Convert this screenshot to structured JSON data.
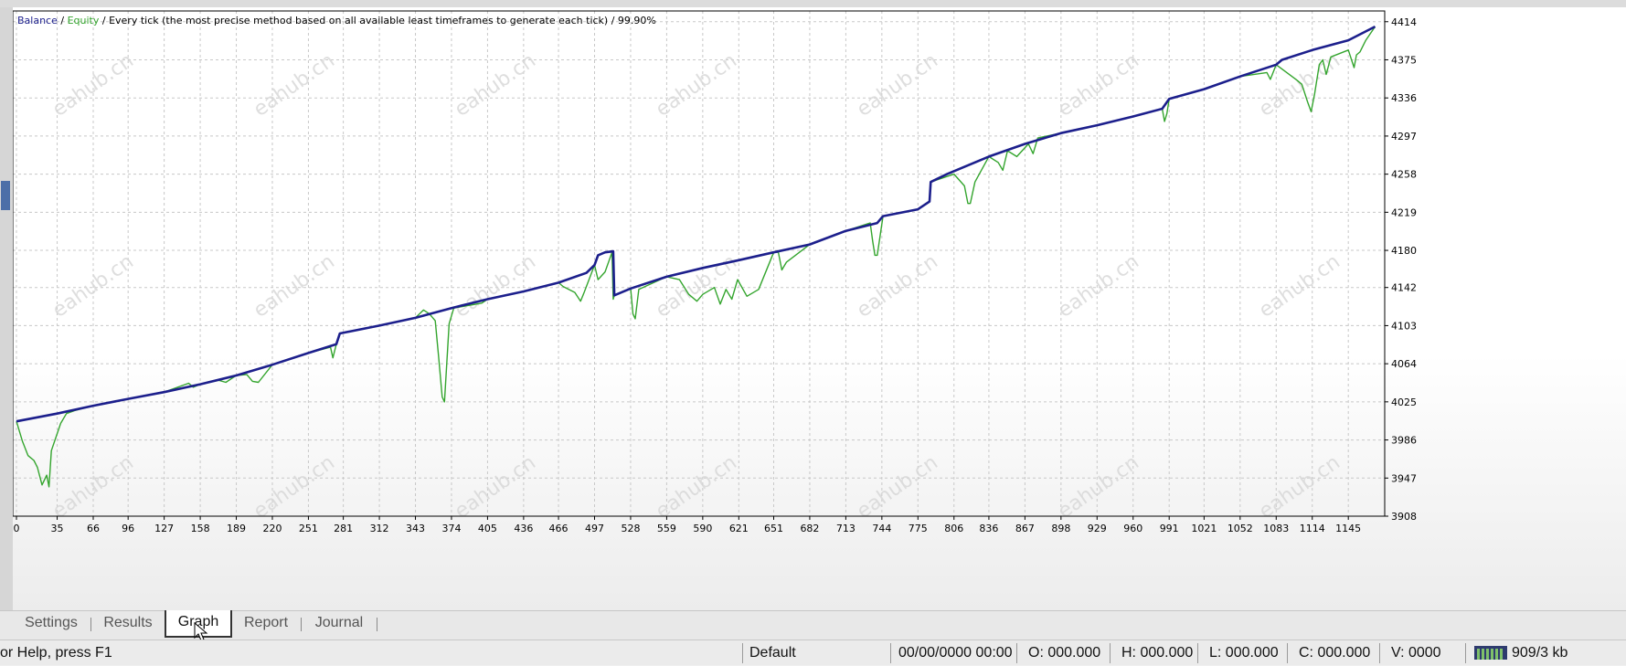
{
  "chart": {
    "legend": {
      "balance_label": "Balance",
      "sep1": " / ",
      "equity_label": "Equity",
      "description": " / Every tick (the most precise method based on all available least timeframes to generate each tick) / 99.90%"
    },
    "watermark": "eahub.cn",
    "colors": {
      "balance": "#1c1f8c",
      "equity": "#34a52e",
      "grid": "#c8c8c8",
      "axis": "#000000"
    }
  },
  "chart_data": {
    "type": "line",
    "title": "",
    "x_ticks": [
      0,
      35,
      66,
      96,
      127,
      158,
      189,
      220,
      251,
      281,
      312,
      343,
      374,
      405,
      436,
      466,
      497,
      528,
      559,
      590,
      621,
      651,
      682,
      713,
      744,
      775,
      806,
      836,
      867,
      898,
      929,
      960,
      991,
      1021,
      1052,
      1083,
      1114,
      1145
    ],
    "y_ticks": [
      3908,
      3947,
      3986,
      4025,
      4064,
      4103,
      4142,
      4180,
      4219,
      4258,
      4297,
      4336,
      4375,
      4414
    ],
    "xlim": [
      0,
      1170
    ],
    "ylim": [
      3908,
      4425
    ],
    "grid": true,
    "legend_position": "top-left",
    "series": [
      {
        "name": "Balance",
        "x": [
          0,
          35,
          66,
          96,
          127,
          158,
          189,
          220,
          251,
          275,
          278,
          312,
          343,
          374,
          405,
          436,
          466,
          490,
          497,
          500,
          506,
          513,
          514,
          528,
          559,
          590,
          621,
          651,
          682,
          713,
          740,
          745,
          775,
          785,
          786,
          800,
          836,
          867,
          898,
          929,
          960,
          985,
          991,
          1021,
          1052,
          1083,
          1088,
          1114,
          1145,
          1168
        ],
        "y": [
          4005,
          4013,
          4021,
          4028,
          4035,
          4043,
          4052,
          4063,
          4075,
          4084,
          4095,
          4103,
          4111,
          4121,
          4130,
          4138,
          4147,
          4157,
          4165,
          4175,
          4178,
          4179,
          4134,
          4141,
          4153,
          4162,
          4170,
          4178,
          4186,
          4200,
          4208,
          4215,
          4222,
          4230,
          4250,
          4258,
          4276,
          4289,
          4300,
          4308,
          4317,
          4325,
          4335,
          4345,
          4358,
          4370,
          4375,
          4385,
          4395,
          4409
        ]
      },
      {
        "name": "Equity",
        "x": [
          0,
          5,
          10,
          15,
          18,
          22,
          26,
          28,
          30,
          38,
          43,
          50,
          66,
          96,
          127,
          148,
          152,
          158,
          174,
          180,
          189,
          198,
          203,
          208,
          220,
          251,
          270,
          272,
          275,
          278,
          312,
          343,
          350,
          355,
          360,
          363,
          366,
          368,
          372,
          376,
          400,
          405,
          436,
          466,
          470,
          480,
          485,
          488,
          497,
          500,
          506,
          512,
          513,
          514,
          528,
          530,
          532,
          535,
          559,
          570,
          578,
          585,
          590,
          600,
          605,
          610,
          615,
          620,
          628,
          638,
          651,
          655,
          658,
          662,
          682,
          713,
          734,
          736,
          738,
          740,
          745,
          775,
          785,
          786,
          806,
          815,
          818,
          820,
          824,
          836,
          844,
          848,
          852,
          860,
          870,
          874,
          878,
          898,
          929,
          960,
          985,
          987,
          989,
          991,
          1021,
          1052,
          1075,
          1078,
          1083,
          1100,
          1105,
          1110,
          1113,
          1116,
          1120,
          1123,
          1126,
          1130,
          1145,
          1150,
          1152,
          1155,
          1160,
          1168
        ],
        "y": [
          4005,
          3985,
          3970,
          3965,
          3958,
          3940,
          3950,
          3938,
          3975,
          4003,
          4013,
          4016,
          4021,
          4028,
          4035,
          4044,
          4040,
          4043,
          4047,
          4045,
          4052,
          4053,
          4046,
          4045,
          4063,
          4075,
          4081,
          4070,
          4084,
          4095,
          4103,
          4111,
          4119,
          4115,
          4108,
          4070,
          4030,
          4025,
          4105,
          4121,
          4126,
          4130,
          4138,
          4147,
          4143,
          4137,
          4128,
          4137,
          4165,
          4150,
          4158,
          4178,
          4130,
          4134,
          4141,
          4115,
          4110,
          4140,
          4153,
          4150,
          4135,
          4128,
          4135,
          4142,
          4125,
          4140,
          4130,
          4150,
          4133,
          4140,
          4178,
          4178,
          4160,
          4168,
          4186,
          4200,
          4208,
          4190,
          4175,
          4175,
          4215,
          4222,
          4230,
          4250,
          4258,
          4246,
          4228,
          4228,
          4250,
          4276,
          4270,
          4262,
          4282,
          4276,
          4289,
          4279,
          4295,
          4300,
          4308,
          4317,
          4325,
          4312,
          4320,
          4335,
          4345,
          4358,
          4362,
          4355,
          4370,
          4355,
          4350,
          4332,
          4322,
          4340,
          4370,
          4375,
          4360,
          4378,
          4385,
          4367,
          4380,
          4383,
          4395,
          4409
        ]
      }
    ]
  },
  "tabs": [
    {
      "label": "Settings"
    },
    {
      "label": "Results"
    },
    {
      "label": "Graph",
      "active": true
    },
    {
      "label": "Report"
    },
    {
      "label": "Journal"
    }
  ],
  "status": {
    "help": "or Help, press F1",
    "profile": "Default",
    "datetime": "00/00/0000 00:00",
    "open": "O: 000.000",
    "high": "H: 000.000",
    "low": "L: 000.000",
    "close": "C: 000.000",
    "volume": "V: 0000",
    "traffic": "909/3 kb"
  }
}
